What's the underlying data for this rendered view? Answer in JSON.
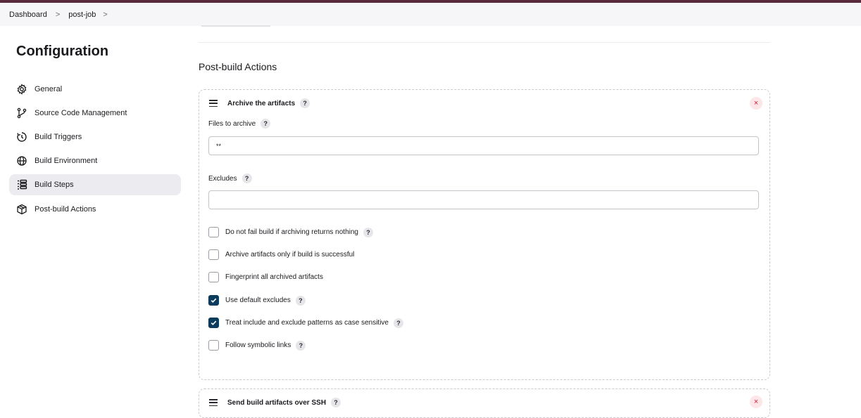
{
  "breadcrumb": {
    "items": [
      "Dashboard",
      "post-job"
    ],
    "sep": ">"
  },
  "sidebar": {
    "title": "Configuration",
    "items": [
      {
        "label": "General",
        "icon": "gear-icon"
      },
      {
        "label": "Source Code Management",
        "icon": "branch-icon"
      },
      {
        "label": "Build Triggers",
        "icon": "timer-icon"
      },
      {
        "label": "Build Environment",
        "icon": "globe-icon"
      },
      {
        "label": "Build Steps",
        "icon": "list-icon",
        "active": true
      },
      {
        "label": "Post-build Actions",
        "icon": "package-icon"
      }
    ]
  },
  "main": {
    "section_title": "Post-build Actions",
    "card1": {
      "title": "Archive the artifacts",
      "files_label": "Files to archive",
      "files_value": "**",
      "excludes_label": "Excludes",
      "excludes_value": "",
      "options": [
        {
          "label": "Do not fail build if archiving returns nothing",
          "checked": false,
          "help": true
        },
        {
          "label": "Archive artifacts only if build is successful",
          "checked": false,
          "help": false
        },
        {
          "label": "Fingerprint all archived artifacts",
          "checked": false,
          "help": false
        },
        {
          "label": "Use default excludes",
          "checked": true,
          "help": true
        },
        {
          "label": "Treat include and exclude patterns as case sensitive",
          "checked": true,
          "help": true
        },
        {
          "label": "Follow symbolic links",
          "checked": false,
          "help": true
        }
      ]
    },
    "card2": {
      "title": "Send build artifacts over SSH"
    }
  },
  "ui": {
    "help_glyph": "?",
    "close_glyph": "×"
  },
  "colors": {
    "accent": "#0c3b5e",
    "topbar": "#5a2a3c",
    "close_bg": "#fde6e8",
    "close_fg": "#d0203a"
  }
}
